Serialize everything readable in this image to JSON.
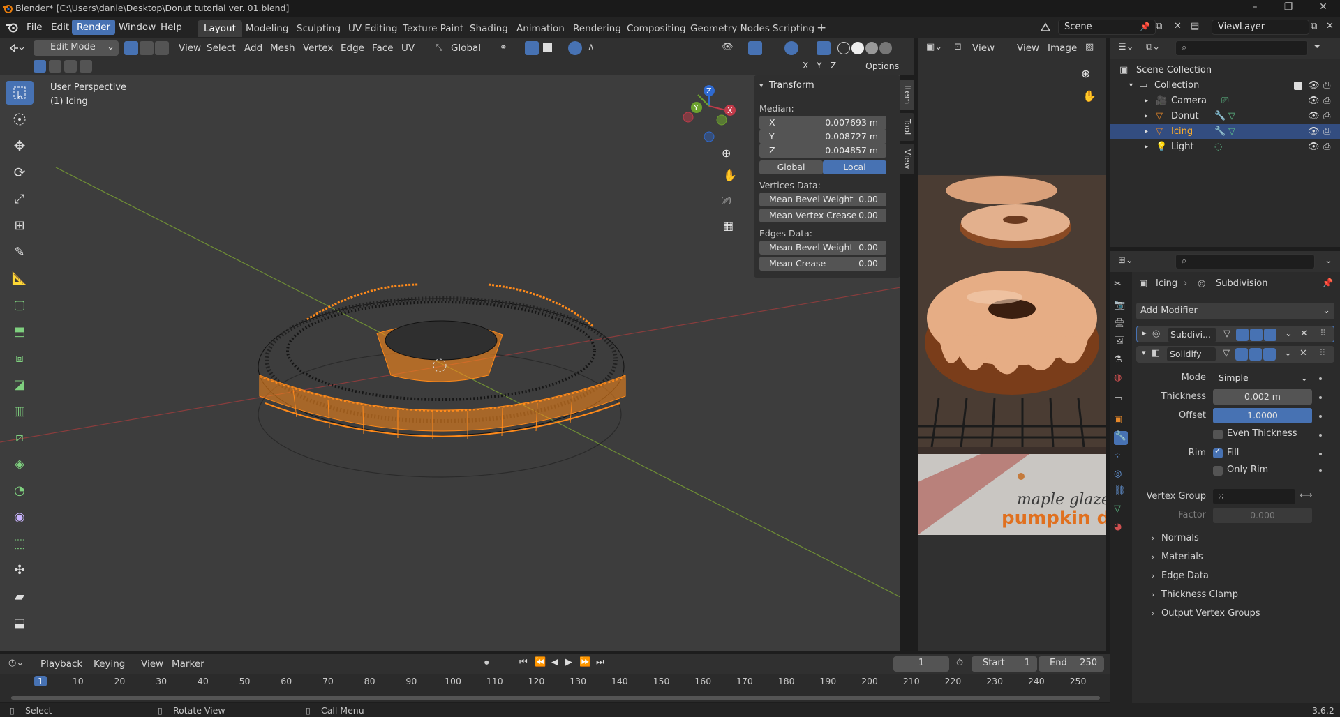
{
  "window": {
    "title": "Blender* [C:\\Users\\danie\\Desktop\\Donut tutorial ver. 01.blend]"
  },
  "menus": [
    "File",
    "Edit",
    "Render",
    "Window",
    "Help"
  ],
  "workspaces": [
    "Layout",
    "Modeling",
    "Sculpting",
    "UV Editing",
    "Texture Paint",
    "Shading",
    "Animation",
    "Rendering",
    "Compositing",
    "Geometry Nodes",
    "Scripting"
  ],
  "scene": {
    "name": "Scene",
    "view_layer": "ViewLayer"
  },
  "viewport": {
    "mode": "Edit Mode",
    "header_menus": [
      "View",
      "Select",
      "Add",
      "Mesh",
      "Vertex",
      "Edge",
      "Face",
      "UV"
    ],
    "orientation": "Global",
    "overlay_text": {
      "perspective": "User Perspective",
      "object": "(1) Icing"
    },
    "axis": {
      "x": "X",
      "y": "Y",
      "z": "Z"
    },
    "options_label": "Options"
  },
  "npanel": {
    "section": "Transform",
    "median_label": "Median:",
    "median": [
      {
        "axis": "X",
        "value": "0.007693 m"
      },
      {
        "axis": "Y",
        "value": "0.008727 m"
      },
      {
        "axis": "Z",
        "value": "0.004857 m"
      }
    ],
    "space_global": "Global",
    "space_local": "Local",
    "vertices_label": "Vertices Data:",
    "vertices": [
      {
        "label": "Mean Bevel Weight",
        "value": "0.00"
      },
      {
        "label": "Mean Vertex Crease",
        "value": "0.00"
      }
    ],
    "edges_label": "Edges Data:",
    "edges": [
      {
        "label": "Mean Bevel Weight",
        "value": "0.00"
      },
      {
        "label": "Mean Crease",
        "value": "0.00"
      }
    ],
    "tabs": [
      "Item",
      "Tool",
      "View"
    ]
  },
  "image_editor": {
    "menus": [
      "View",
      "View",
      "Image"
    ],
    "caption_line1": "maple glazed",
    "caption_line2": "pumpkin donut"
  },
  "outliner": {
    "root": "Scene Collection",
    "collection": "Collection",
    "items": [
      "Camera",
      "Donut",
      "Icing",
      "Light"
    ]
  },
  "properties": {
    "breadcrumb_object": "Icing",
    "breadcrumb_modifier": "Subdivision",
    "add_modifier": "Add Modifier",
    "modifiers": [
      "Subdivi...",
      "Solidify"
    ],
    "mode_label": "Mode",
    "mode_value": "Simple",
    "thickness_label": "Thickness",
    "thickness_value": "0.002 m",
    "offset_label": "Offset",
    "offset_value": "1.0000",
    "offset_fraction": 1.0,
    "even_thickness": "Even Thickness",
    "rim_label": "Rim",
    "rim_fill": "Fill",
    "only_rim": "Only Rim",
    "vertex_group_label": "Vertex Group",
    "factor_label": "Factor",
    "factor_value": "0.000",
    "subpanels": [
      "Normals",
      "Materials",
      "Edge Data",
      "Thickness Clamp",
      "Output Vertex Groups"
    ]
  },
  "timeline": {
    "menus": [
      "Playback",
      "Keying",
      "View",
      "Marker"
    ],
    "current_frame": "1",
    "start_label": "Start",
    "start": "1",
    "end_label": "End",
    "end": "250",
    "frames": [
      1,
      10,
      20,
      30,
      40,
      50,
      60,
      70,
      80,
      90,
      100,
      110,
      120,
      130,
      140,
      150,
      160,
      170,
      180,
      190,
      200,
      210,
      220,
      230,
      240,
      250
    ]
  },
  "status": {
    "select": "Select",
    "rotate": "Rotate View",
    "menu": "Call Menu",
    "version": "3.6.2"
  },
  "colors": {
    "accent": "#4772b3",
    "selection": "#ff8a1a",
    "outliner_select": "#334d80"
  }
}
